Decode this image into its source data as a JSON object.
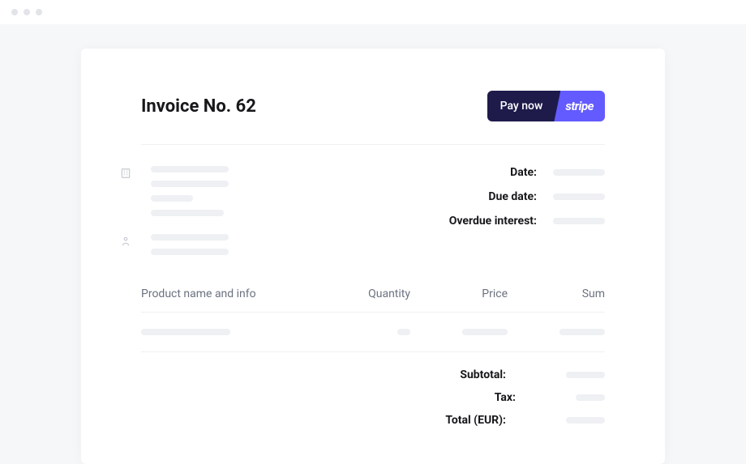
{
  "invoice": {
    "title": "Invoice No. 62",
    "pay_button_label": "Pay now",
    "pay_provider": "stripe"
  },
  "meta": {
    "date_label": "Date:",
    "due_date_label": "Due date:",
    "overdue_label": "Overdue interest:"
  },
  "columns": {
    "name": "Product name and info",
    "qty": "Quantity",
    "price": "Price",
    "sum": "Sum"
  },
  "totals": {
    "subtotal_label": "Subtotal:",
    "tax_label": "Tax:",
    "total_label": "Total (EUR):"
  }
}
